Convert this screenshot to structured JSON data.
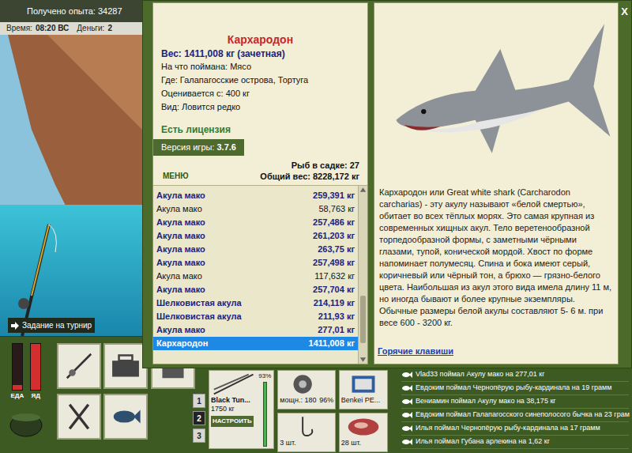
{
  "hud": {
    "experience": "Получено опыта: 34287",
    "time_label": "Время:",
    "time": "08:20 ВС",
    "money_label": "Деньги:",
    "money": "2"
  },
  "scene": {
    "task_button": "Задание на турнир"
  },
  "meters": [
    {
      "label": "ЕДА",
      "level": 0.1
    },
    {
      "label": "ЯД",
      "level": 1
    }
  ],
  "slots": [
    {
      "label": "1",
      "selected": false
    },
    {
      "label": "2",
      "selected": true
    },
    {
      "label": "3",
      "selected": false
    }
  ],
  "tackle": {
    "rod_name": "Black Tun...",
    "rod_test": "1750 кг",
    "rod_condition": "93%",
    "setup_button": "НАСТРОИТЬ",
    "reel_power": "мощн.: 180",
    "reel_condition": "96%",
    "line_name": "Benkei PE...",
    "hooks_count": "3 шт.",
    "bait_count": "28 шт."
  },
  "feed": [
    "Vlad33 поймал Акулу мако на 277,01 кг",
    "Евдоким поймал Чернопёрую рыбу-кардинала на 19 грамм",
    "Вениамин поймал Акулу мако на 38,175 кг",
    "Евдоким поймал Галапагосского синеполосого бычка на 23 грам",
    "Илья поймал Чернопёрую рыбу-кардинала на 17 грамм",
    "Илья поймал Губана арлекина на 1,62 кг"
  ],
  "dialog": {
    "close": "X",
    "fish": {
      "name": "Кархародон",
      "weight": "Вес: 1411,008 кг (зачетная)",
      "info": [
        "На что поймана: Мясо",
        "Где: Галапагосские острова, Тортуга",
        "Оценивается с: 400 кг",
        "Вид: Ловится редко"
      ],
      "license": "Есть лицензия"
    },
    "version_label": "Версия игры:",
    "version": "3.7.6",
    "menu_button": "МЕНЮ",
    "fish_count": "Рыб в садке: 27",
    "total_weight": "Общий вес: 8228,172 кг",
    "catch": [
      {
        "name": "Акула мако",
        "weight": "259,391 кг",
        "trophy": true,
        "selected": false
      },
      {
        "name": "Акула мако",
        "weight": "58,763 кг",
        "trophy": false,
        "selected": false
      },
      {
        "name": "Акула мако",
        "weight": "257,486 кг",
        "trophy": true,
        "selected": false
      },
      {
        "name": "Акула мако",
        "weight": "261,203 кг",
        "trophy": true,
        "selected": false
      },
      {
        "name": "Акула мако",
        "weight": "263,75 кг",
        "trophy": true,
        "selected": false
      },
      {
        "name": "Акула мако",
        "weight": "257,498 кг",
        "trophy": true,
        "selected": false
      },
      {
        "name": "Акула мако",
        "weight": "117,632 кг",
        "trophy": false,
        "selected": false
      },
      {
        "name": "Акула мако",
        "weight": "257,704 кг",
        "trophy": true,
        "selected": false
      },
      {
        "name": "Шелковистая акула",
        "weight": "214,119 кг",
        "trophy": true,
        "selected": false
      },
      {
        "name": "Шелковистая акула",
        "weight": "211,93 кг",
        "trophy": true,
        "selected": false
      },
      {
        "name": "Акула мако",
        "weight": "277,01 кг",
        "trophy": true,
        "selected": false
      },
      {
        "name": "Кархародон",
        "weight": "1411,008 кг",
        "trophy": true,
        "selected": true
      }
    ],
    "description": "Кархародон или Great white shark (Carcharodon carcharias) - эту акулу называют «белой смертью», обитает во всех тёплых морях. Это самая крупная из современных хищных акул. Тело веретенообразной торпедообразной формы, с заметными чёрными глазами, тупой, конической мордой. Хвост по форме напоминает полумесяц. Спина и бока имеют серый, коричневый или чёрный тон, а брюхо — грязно-белого цвета. Наибольшая из акул этого вида имела длину 11 м, но иногда бывают и более крупные экземпляры. Обычные размеры белой акулы составляют 5- 6 м. при весе 600 - 3200 кг.",
    "hotkeys_link": "Горячие клавиши"
  }
}
